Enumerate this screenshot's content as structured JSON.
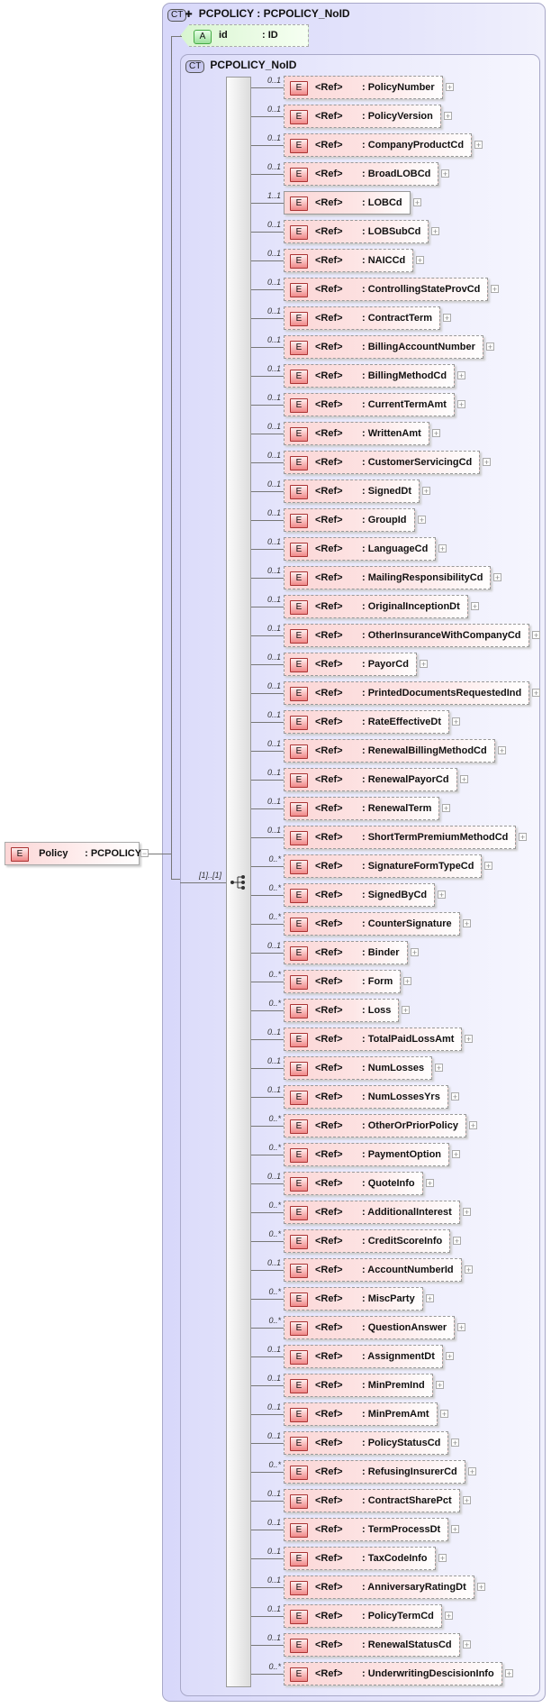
{
  "root": {
    "badge": "E",
    "name": "Policy",
    "type": ": PCPOLICY",
    "expander": "−"
  },
  "outer_ct": {
    "badge": "CT",
    "name": "PCPOLICY : PCPOLICY_NoID"
  },
  "attribute": {
    "badge": "A",
    "name": "id",
    "type": ": ID"
  },
  "inner_ct": {
    "badge": "CT",
    "name": "PCPOLICY_NoID"
  },
  "sequence": {
    "cardinality": "[1]..[1]",
    "icon": "sequence-icon"
  },
  "colors": {
    "element": "#fcd6d6",
    "attribute": "#d8f5d0",
    "complex_type": "#dcdcfa"
  },
  "elements": [
    {
      "card": "0..1",
      "ref": "<Ref>",
      "name": ": PolicyNumber"
    },
    {
      "card": "0..1",
      "ref": "<Ref>",
      "name": ": PolicyVersion"
    },
    {
      "card": "0..1",
      "ref": "<Ref>",
      "name": ": CompanyProductCd"
    },
    {
      "card": "0..1",
      "ref": "<Ref>",
      "name": ": BroadLOBCd"
    },
    {
      "card": "1..1",
      "ref": "<Ref>",
      "name": ": LOBCd"
    },
    {
      "card": "0..1",
      "ref": "<Ref>",
      "name": ": LOBSubCd"
    },
    {
      "card": "0..1",
      "ref": "<Ref>",
      "name": ": NAICCd"
    },
    {
      "card": "0..1",
      "ref": "<Ref>",
      "name": ": ControllingStateProvCd"
    },
    {
      "card": "0..1",
      "ref": "<Ref>",
      "name": ": ContractTerm"
    },
    {
      "card": "0..1",
      "ref": "<Ref>",
      "name": ": BillingAccountNumber"
    },
    {
      "card": "0..1",
      "ref": "<Ref>",
      "name": ": BillingMethodCd"
    },
    {
      "card": "0..1",
      "ref": "<Ref>",
      "name": ": CurrentTermAmt"
    },
    {
      "card": "0..1",
      "ref": "<Ref>",
      "name": ": WrittenAmt"
    },
    {
      "card": "0..1",
      "ref": "<Ref>",
      "name": ": CustomerServicingCd"
    },
    {
      "card": "0..1",
      "ref": "<Ref>",
      "name": ": SignedDt"
    },
    {
      "card": "0..1",
      "ref": "<Ref>",
      "name": ": GroupId"
    },
    {
      "card": "0..1",
      "ref": "<Ref>",
      "name": ": LanguageCd"
    },
    {
      "card": "0..1",
      "ref": "<Ref>",
      "name": ": MailingResponsibilityCd"
    },
    {
      "card": "0..1",
      "ref": "<Ref>",
      "name": ": OriginalInceptionDt"
    },
    {
      "card": "0..1",
      "ref": "<Ref>",
      "name": ": OtherInsuranceWithCompanyCd"
    },
    {
      "card": "0..1",
      "ref": "<Ref>",
      "name": ": PayorCd"
    },
    {
      "card": "0..1",
      "ref": "<Ref>",
      "name": ": PrintedDocumentsRequestedInd"
    },
    {
      "card": "0..1",
      "ref": "<Ref>",
      "name": ": RateEffectiveDt"
    },
    {
      "card": "0..1",
      "ref": "<Ref>",
      "name": ": RenewalBillingMethodCd"
    },
    {
      "card": "0..1",
      "ref": "<Ref>",
      "name": ": RenewalPayorCd"
    },
    {
      "card": "0..1",
      "ref": "<Ref>",
      "name": ": RenewalTerm"
    },
    {
      "card": "0..1",
      "ref": "<Ref>",
      "name": ": ShortTermPremiumMethodCd"
    },
    {
      "card": "0..*",
      "ref": "<Ref>",
      "name": ": SignatureFormTypeCd"
    },
    {
      "card": "0..*",
      "ref": "<Ref>",
      "name": ": SignedByCd"
    },
    {
      "card": "0..*",
      "ref": "<Ref>",
      "name": ": CounterSignature"
    },
    {
      "card": "0..1",
      "ref": "<Ref>",
      "name": ": Binder"
    },
    {
      "card": "0..*",
      "ref": "<Ref>",
      "name": ": Form"
    },
    {
      "card": "0..*",
      "ref": "<Ref>",
      "name": ": Loss"
    },
    {
      "card": "0..1",
      "ref": "<Ref>",
      "name": ": TotalPaidLossAmt"
    },
    {
      "card": "0..1",
      "ref": "<Ref>",
      "name": ": NumLosses"
    },
    {
      "card": "0..1",
      "ref": "<Ref>",
      "name": ": NumLossesYrs"
    },
    {
      "card": "0..*",
      "ref": "<Ref>",
      "name": ": OtherOrPriorPolicy"
    },
    {
      "card": "0..*",
      "ref": "<Ref>",
      "name": ": PaymentOption"
    },
    {
      "card": "0..1",
      "ref": "<Ref>",
      "name": ": QuoteInfo"
    },
    {
      "card": "0..*",
      "ref": "<Ref>",
      "name": ": AdditionalInterest"
    },
    {
      "card": "0..*",
      "ref": "<Ref>",
      "name": ": CreditScoreInfo"
    },
    {
      "card": "0..1",
      "ref": "<Ref>",
      "name": ": AccountNumberId"
    },
    {
      "card": "0..*",
      "ref": "<Ref>",
      "name": ": MiscParty"
    },
    {
      "card": "0..*",
      "ref": "<Ref>",
      "name": ": QuestionAnswer"
    },
    {
      "card": "0..1",
      "ref": "<Ref>",
      "name": ": AssignmentDt"
    },
    {
      "card": "0..1",
      "ref": "<Ref>",
      "name": ": MinPremInd"
    },
    {
      "card": "0..1",
      "ref": "<Ref>",
      "name": ": MinPremAmt"
    },
    {
      "card": "0..1",
      "ref": "<Ref>",
      "name": ": PolicyStatusCd"
    },
    {
      "card": "0..*",
      "ref": "<Ref>",
      "name": ": RefusingInsurerCd"
    },
    {
      "card": "0..1",
      "ref": "<Ref>",
      "name": ": ContractSharePct"
    },
    {
      "card": "0..1",
      "ref": "<Ref>",
      "name": ": TermProcessDt"
    },
    {
      "card": "0..1",
      "ref": "<Ref>",
      "name": ": TaxCodeInfo"
    },
    {
      "card": "0..1",
      "ref": "<Ref>",
      "name": ": AnniversaryRatingDt"
    },
    {
      "card": "0..1",
      "ref": "<Ref>",
      "name": ": PolicyTermCd"
    },
    {
      "card": "0..1",
      "ref": "<Ref>",
      "name": ": RenewalStatusCd"
    },
    {
      "card": "0..*",
      "ref": "<Ref>",
      "name": ": UnderwritingDescisionInfo"
    }
  ]
}
